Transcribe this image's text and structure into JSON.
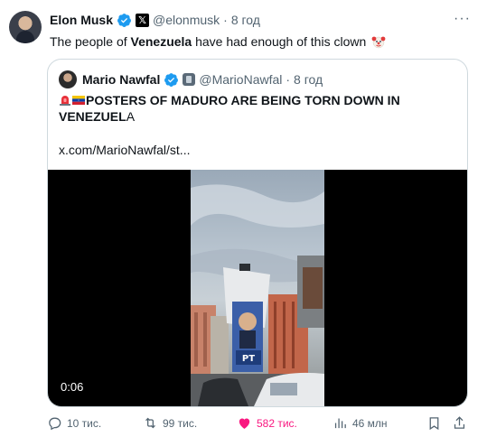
{
  "tweet": {
    "author_name": "Elon Musk",
    "handle": "@elonmusk",
    "separator": "·",
    "time": "8 год",
    "text_before": "The people of ",
    "text_bold": "Venezuela",
    "text_after": " have had enough of this clown",
    "more_label": "···"
  },
  "quote": {
    "author_name": "Mario Nawfal",
    "handle": "@MarioNawfal",
    "separator": "·",
    "time": "8 год",
    "headline": "POSTERS OF MADURO ARE BEING TORN DOWN IN VENEZUEL",
    "headline_tail": "A",
    "link": "x.com/MarioNawfal/st...",
    "video_time": "0:06",
    "poster_label": "PT"
  },
  "actions": {
    "replies": "10 тис.",
    "retweets": "99 тис.",
    "likes": "582 тис.",
    "views": "46 млн"
  },
  "colors": {
    "verified": "#1d9bf0",
    "like": "#f91880",
    "muted": "#536471",
    "border": "#cfd9de"
  }
}
